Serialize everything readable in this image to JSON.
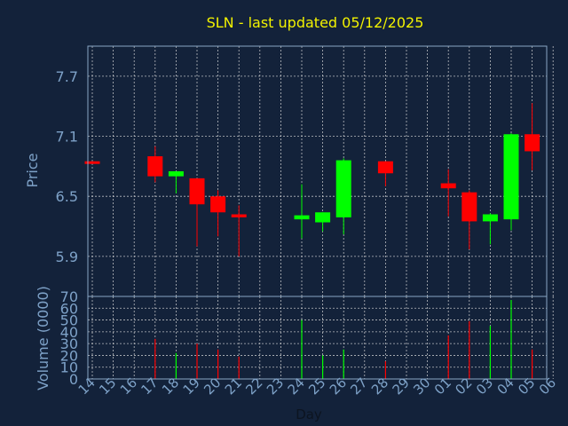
{
  "chart_data": [
    {
      "type": "candlestick",
      "title": "SLN - last updated 05/12/2025",
      "ylabel": "Price",
      "ylim": [
        5.5,
        8.0
      ],
      "yticks": [
        5.9,
        6.5,
        7.1,
        7.7
      ],
      "ytick_labels": [
        "5.9",
        "6.5",
        "7.1",
        "7.7"
      ],
      "grid": true,
      "colors": {
        "up": "#00ff00",
        "down": "#ff0000",
        "background": "#13223a",
        "title": "#f2f200",
        "axis_text": "#7ea2c8"
      },
      "candles": [
        {
          "day": "14",
          "open": 6.85,
          "high": 6.85,
          "low": 6.83,
          "close": 6.83
        },
        {
          "day": "17",
          "open": 6.9,
          "high": 7.0,
          "low": 6.64,
          "close": 6.7
        },
        {
          "day": "18",
          "open": 6.7,
          "high": 6.74,
          "low": 6.53,
          "close": 6.75
        },
        {
          "day": "19",
          "open": 6.68,
          "high": 6.68,
          "low": 6.0,
          "close": 6.42
        },
        {
          "day": "20",
          "open": 6.5,
          "high": 6.56,
          "low": 6.1,
          "close": 6.34
        },
        {
          "day": "21",
          "open": 6.32,
          "high": 6.41,
          "low": 5.9,
          "close": 6.29
        },
        {
          "day": "24",
          "open": 6.27,
          "high": 6.62,
          "low": 6.08,
          "close": 6.31
        },
        {
          "day": "25",
          "open": 6.24,
          "high": 6.34,
          "low": 6.15,
          "close": 6.34
        },
        {
          "day": "26",
          "open": 6.29,
          "high": 6.88,
          "low": 6.12,
          "close": 6.86
        },
        {
          "day": "28",
          "open": 6.85,
          "high": 6.85,
          "low": 6.6,
          "close": 6.73
        },
        {
          "day": "01",
          "open": 6.63,
          "high": 6.77,
          "low": 6.3,
          "close": 6.58
        },
        {
          "day": "02",
          "open": 6.54,
          "high": 6.56,
          "low": 5.97,
          "close": 6.25
        },
        {
          "day": "03",
          "open": 6.25,
          "high": 6.33,
          "low": 6.02,
          "close": 6.32
        },
        {
          "day": "04",
          "open": 6.27,
          "high": 7.13,
          "low": 6.16,
          "close": 7.12
        },
        {
          "day": "05",
          "open": 7.12,
          "high": 7.43,
          "low": 6.76,
          "close": 6.95
        }
      ]
    },
    {
      "type": "bar",
      "ylabel": "Volume (0000)",
      "xlabel": "Day",
      "ylim": [
        0,
        70
      ],
      "yticks": [
        0,
        10,
        20,
        30,
        40,
        50,
        60,
        70
      ],
      "ytick_labels": [
        "0",
        "10",
        "20",
        "30",
        "40",
        "50",
        "60",
        "70"
      ],
      "categories": [
        "14",
        "15",
        "16",
        "17",
        "18",
        "19",
        "20",
        "21",
        "22",
        "23",
        "24",
        "25",
        "26",
        "27",
        "28",
        "29",
        "30",
        "01",
        "02",
        "03",
        "04",
        "05",
        "06"
      ],
      "bars": [
        {
          "day": "14",
          "value": 0,
          "direction": "down"
        },
        {
          "day": "17",
          "value": 34,
          "direction": "down"
        },
        {
          "day": "18",
          "value": 22,
          "direction": "up"
        },
        {
          "day": "19",
          "value": 30,
          "direction": "down"
        },
        {
          "day": "20",
          "value": 25,
          "direction": "down"
        },
        {
          "day": "21",
          "value": 19,
          "direction": "down"
        },
        {
          "day": "24",
          "value": 50,
          "direction": "up"
        },
        {
          "day": "25",
          "value": 20,
          "direction": "up"
        },
        {
          "day": "26",
          "value": 25,
          "direction": "up"
        },
        {
          "day": "28",
          "value": 15,
          "direction": "down"
        },
        {
          "day": "01",
          "value": 37,
          "direction": "down"
        },
        {
          "day": "02",
          "value": 49,
          "direction": "down"
        },
        {
          "day": "03",
          "value": 45,
          "direction": "up"
        },
        {
          "day": "04",
          "value": 67,
          "direction": "up"
        },
        {
          "day": "05",
          "value": 25,
          "direction": "down"
        }
      ],
      "colors": {
        "up": "#00ff00",
        "down": "#ff0000"
      }
    }
  ]
}
